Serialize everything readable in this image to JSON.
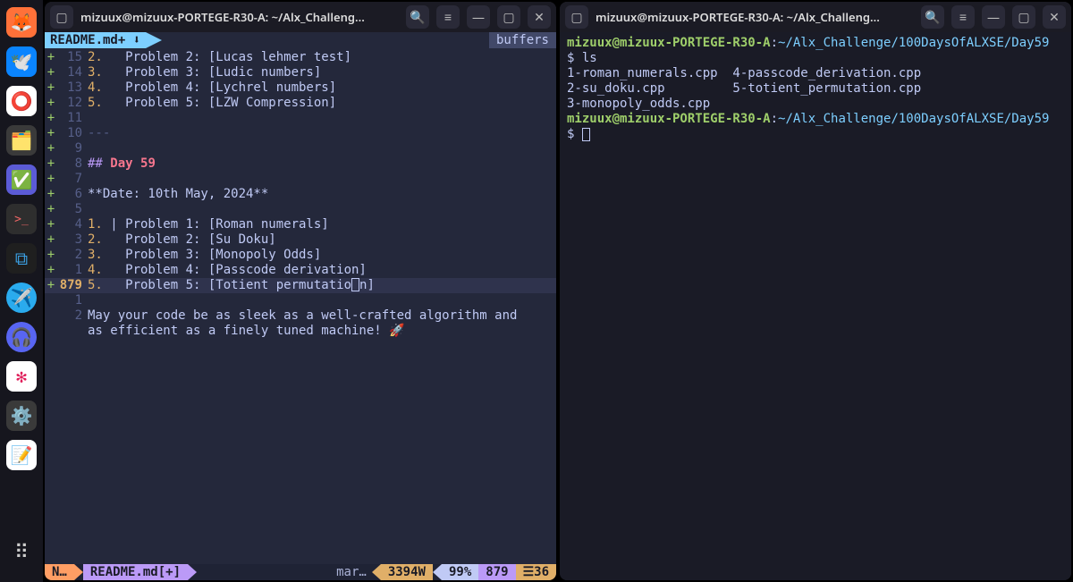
{
  "dock": {
    "items": [
      {
        "name": "firefox-icon",
        "glyph": "🦊"
      },
      {
        "name": "thunderbird-icon",
        "glyph": "🕊️"
      },
      {
        "name": "chrome-icon",
        "glyph": "⭕"
      },
      {
        "name": "files-icon",
        "glyph": "🗂️"
      },
      {
        "name": "todo-icon",
        "glyph": "✅"
      },
      {
        "name": "terminal-icon",
        "glyph": ">_"
      },
      {
        "name": "vscode-icon",
        "glyph": "⧉"
      },
      {
        "name": "telegram-icon",
        "glyph": "✈️"
      },
      {
        "name": "discord-icon",
        "glyph": "🎧"
      },
      {
        "name": "slack-icon",
        "glyph": "✻"
      },
      {
        "name": "settings-icon",
        "glyph": "⚙️"
      },
      {
        "name": "text-editor-icon",
        "glyph": "📝"
      }
    ],
    "apps_label": "⠿"
  },
  "left_window": {
    "title": "mizuux@mizuux-PORTEGE-R30-A: ~/Alx_Challeng...",
    "tab_filename": "README.md+ ⬇",
    "buffers_label": "buffers",
    "lines": [
      {
        "sign": "+",
        "num": "15",
        "code": "2.   Problem 2: [Lucas lehmer test]",
        "cls": "num"
      },
      {
        "sign": "+",
        "num": "14",
        "code": "3.   Problem 3: [Ludic numbers]",
        "cls": "num"
      },
      {
        "sign": "+",
        "num": "13",
        "code": "4.   Problem 4: [Lychrel numbers]",
        "cls": "num"
      },
      {
        "sign": "+",
        "num": "12",
        "code": "5.   Problem 5: [LZW Compression]",
        "cls": "num"
      },
      {
        "sign": "+",
        "num": "11",
        "code": ""
      },
      {
        "sign": "+",
        "num": "10",
        "code": "---",
        "cls": "sep"
      },
      {
        "sign": "+",
        "num": "9",
        "code": ""
      },
      {
        "sign": "+",
        "num": "8",
        "code": "## Day 59",
        "cls": "h2"
      },
      {
        "sign": "+",
        "num": "7",
        "code": ""
      },
      {
        "sign": "+",
        "num": "6",
        "code": "**Date: 10th May, 2024**"
      },
      {
        "sign": "+",
        "num": "5",
        "code": ""
      },
      {
        "sign": "+",
        "num": "4",
        "code": "1. | Problem 1: [Roman numerals]",
        "cls": "num"
      },
      {
        "sign": "+",
        "num": "3",
        "code": "2.   Problem 2: [Su Doku]",
        "cls": "num"
      },
      {
        "sign": "+",
        "num": "2",
        "code": "3.   Problem 3: [Monopoly Odds]",
        "cls": "num"
      },
      {
        "sign": "+",
        "num": "1",
        "code": "4.   Problem 4: [Passcode derivation]",
        "cls": "num"
      },
      {
        "sign": "+",
        "num": "879",
        "code": "5.   Problem 5: [Totient permutatio",
        "cls": "num",
        "cursor": true,
        "tail": "n]"
      },
      {
        "sign": " ",
        "num": "1",
        "code": ""
      },
      {
        "sign": " ",
        "num": "2",
        "code": "May your code be as sleek as a well-crafted algorithm and"
      },
      {
        "sign": " ",
        "num": "",
        "code": "as efficient as a finely tuned machine! 🚀"
      }
    ],
    "status": {
      "mode": "N…",
      "file": "README.md[+]",
      "mid": "mar…",
      "warn": "3394W",
      "pct": "99%",
      "line": "879",
      "col": "36",
      "col_prefix": "☰"
    }
  },
  "right_window": {
    "title": "mizuux@mizuux-PORTEGE-R30-A: ~/Alx_Challeng...",
    "prompt_user": "mizuux@mizuux-PORTEGE-R30-A",
    "prompt_sep": ":",
    "prompt_path": "~/Alx_Challenge/100DaysOfALXSE/Day59",
    "cmd1": "ls",
    "ls_output": "1-roman_numerals.cpp  4-passcode_derivation.cpp\n2-su_doku.cpp         5-totient_permutation.cpp\n3-monopoly_odds.cpp",
    "dollar": "$"
  }
}
